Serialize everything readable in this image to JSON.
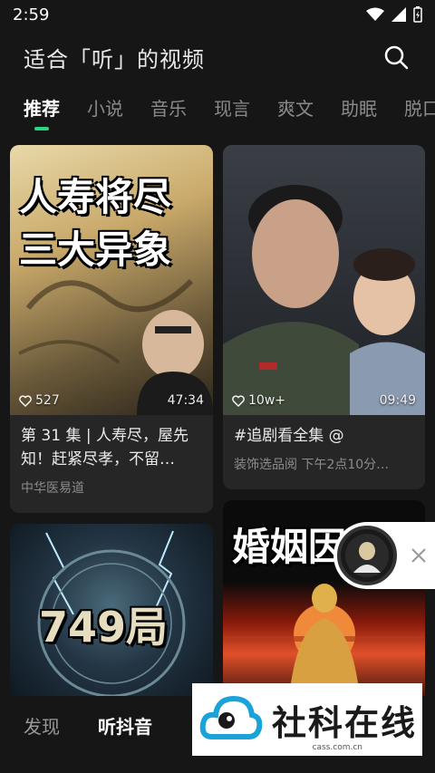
{
  "status": {
    "time": "2:59"
  },
  "header": {
    "title": "适合「听」的视频",
    "search_icon": "search-icon"
  },
  "tabs": [
    {
      "label": "推荐",
      "active": true
    },
    {
      "label": "小说"
    },
    {
      "label": "音乐"
    },
    {
      "label": "现言"
    },
    {
      "label": "爽文"
    },
    {
      "label": "助眠"
    },
    {
      "label": "脱口"
    }
  ],
  "cards": [
    {
      "overlay_lines": [
        "人寿将尽",
        "三大异象"
      ],
      "likes": "527",
      "duration": "47:34",
      "title": "第 31 集 | 人寿尽，屋先知！赶紧尽孝，不留…",
      "subtitle": "中华医易道"
    },
    {
      "likes": "10w+",
      "duration": "09:49",
      "title": "#追剧看全集 @",
      "subtitle": "装饰选品阅  下午2点10分…"
    },
    {
      "overlay": "749局"
    },
    {
      "overlay": "婚姻因果"
    }
  ],
  "bottom_nav": [
    {
      "label": "发现"
    },
    {
      "label": "听抖音",
      "active": true
    }
  ],
  "watermark": {
    "text": "社科在线",
    "url": "cass.com.cn"
  },
  "colors": {
    "accent": "#2bd47e",
    "background": "#161616",
    "card": "#262626"
  }
}
